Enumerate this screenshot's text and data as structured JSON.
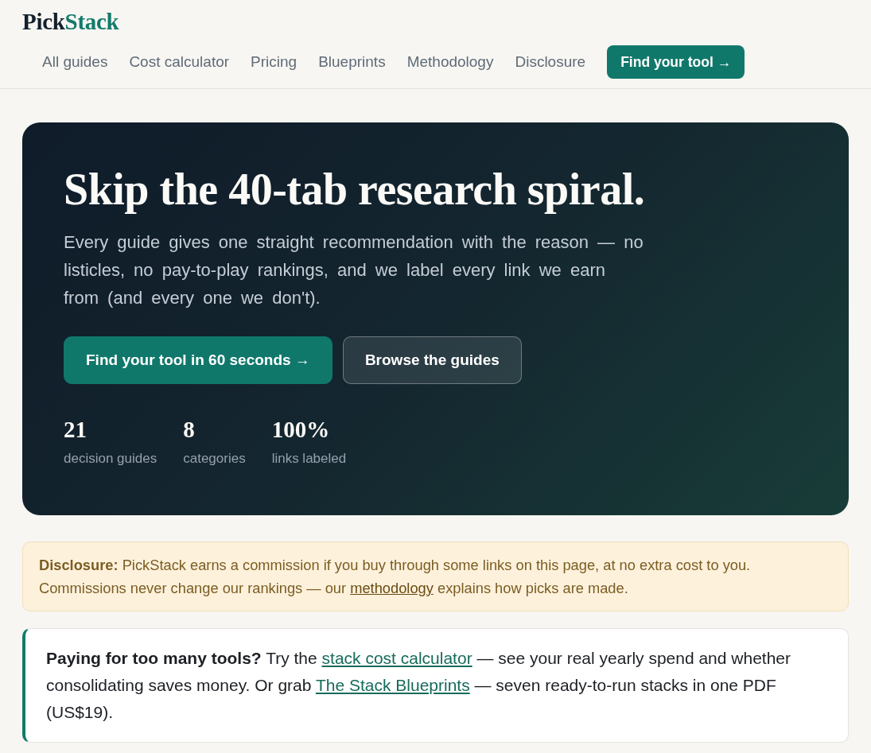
{
  "header": {
    "logo": {
      "lead": "Pick",
      "accent": "Stack"
    },
    "nav": [
      "All guides",
      "Cost calculator",
      "Pricing",
      "Blueprints",
      "Methodology",
      "Disclosure"
    ],
    "cta": "Find your tool →"
  },
  "hero": {
    "title": "Skip the 40-tab research spiral.",
    "subtitle": "Every guide gives one straight recommendation with the reason — no listicles, no pay-to-play rankings, and we label every link we earn from (and every one we don't).",
    "buttons": [
      {
        "kind": "primary",
        "label": "Find your tool in 60 seconds →"
      },
      {
        "kind": "secondary",
        "label": "Browse the guides"
      }
    ],
    "stats": [
      {
        "value": "21",
        "label": "decision guides"
      },
      {
        "value": "8",
        "label": "categories"
      },
      {
        "value": "100%",
        "label": "links labeled"
      }
    ]
  },
  "disclosure": {
    "lines": [
      [
        {
          "kind": "text",
          "text": "**Disclosure:** PickStack earns a commission if you buy through some links on this page, at no extra cost to you."
        }
      ],
      [
        {
          "kind": "text",
          "text": "Commissions never change our rankings — our "
        },
        {
          "kind": "link",
          "text": "methodology"
        },
        {
          "kind": "text",
          "text": " explains how picks are made."
        }
      ]
    ]
  },
  "promo": {
    "segments": [
      {
        "kind": "text",
        "text": "**Paying for too many tools?** Try the "
      },
      {
        "kind": "link",
        "text": "stack cost calculator"
      },
      {
        "kind": "text",
        "text": " — see your real yearly spend and whether consolidating saves money. Or grab "
      },
      {
        "kind": "link",
        "text": "The Stack Blueprints"
      },
      {
        "kind": "text",
        "text": " — seven ready-to-run stacks in one PDF (US$19)."
      }
    ]
  }
}
